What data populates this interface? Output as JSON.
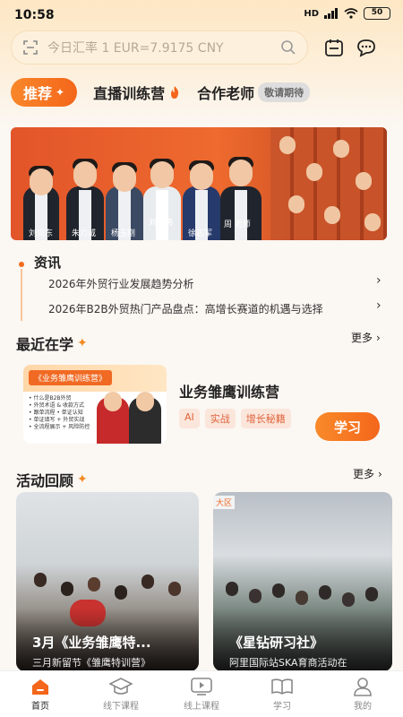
{
  "status_bar": {
    "time": "10:58",
    "signal": "HD",
    "battery": "50"
  },
  "search": {
    "placeholder": "今日汇率 1 EUR=7.9175 CNY"
  },
  "tabs": [
    {
      "label": "推荐",
      "active": true
    },
    {
      "label": "直播训练营"
    },
    {
      "label": "合作老师"
    }
  ],
  "tabs_badge": "敬请期待",
  "banner": {
    "names": [
      "刘向东",
      "朱力威",
      "杨玉刚",
      "刘哲涛",
      "徐志军",
      "周 老师"
    ]
  },
  "news": {
    "title": "资讯",
    "items": [
      "2026年外贸行业发展趋势分析",
      "2026年B2B外贸热门产品盘点：高增长赛道的机遇与选择"
    ]
  },
  "recent": {
    "title": "最近在学",
    "more": "更多",
    "course": {
      "thumb_label": "《业务雏鹰训练营》",
      "thumb_bullets": [
        "• 什么是B2B外贸",
        "• 外贸术语 & 收款方式",
        "• 跟单流程 • 单证认知",
        "• 单证填写 + 外贸实战",
        "• 全流程展示 + 风险防控"
      ],
      "title": "业务雏鹰训练营",
      "tags": [
        "AI",
        "实战",
        "增长秘籍"
      ],
      "button": "学习"
    }
  },
  "activities": {
    "title": "活动回顾",
    "more": "更多",
    "items": [
      {
        "title": "3月《业务雏鹰特...",
        "subtitle": "三月新留节《雏鹰特训营》"
      },
      {
        "title": "《星钻研习社》",
        "subtitle": "阿里国际站SKA育商活动在",
        "tag": "大区"
      }
    ]
  },
  "nav": [
    {
      "label": "首页",
      "icon": "home-icon",
      "active": true
    },
    {
      "label": "线下课程",
      "icon": "graduation-cap-icon"
    },
    {
      "label": "线上课程",
      "icon": "video-play-icon"
    },
    {
      "label": "学习",
      "icon": "book-icon"
    },
    {
      "label": "我的",
      "icon": "user-icon"
    }
  ],
  "colors": {
    "accent": "#f4661b",
    "background": "#fbf7f2"
  }
}
